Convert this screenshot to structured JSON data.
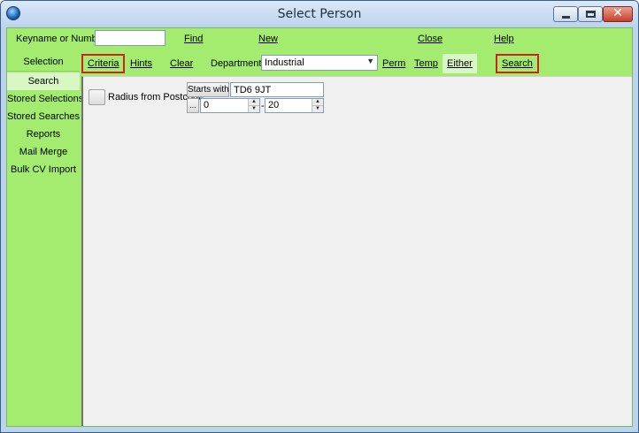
{
  "window": {
    "title": "Select Person",
    "minimize_icon": "minimize-icon",
    "maximize_icon": "maximize-icon",
    "close_icon": "close-icon",
    "close_glyph": "✕"
  },
  "toolbar": {
    "keyname_label": "Keyname or Number",
    "keyname_value": "",
    "find": "Find",
    "new": "New",
    "close": "Close",
    "help": "Help"
  },
  "sidebar": {
    "header": "Selection",
    "items": [
      {
        "label": "Search",
        "active": true
      },
      {
        "label": "Stored Selections"
      },
      {
        "label": "Stored Searches"
      },
      {
        "label": "Reports"
      },
      {
        "label": "Mail Merge"
      },
      {
        "label": "Bulk CV Import"
      }
    ]
  },
  "search_bar": {
    "criteria": "Criteria",
    "hints": "Hints",
    "clear": "Clear",
    "department_label": "Department",
    "department_value": "Industrial",
    "perm": "Perm",
    "temp": "Temp",
    "either": "Either",
    "search": "Search",
    "highlight_color": "#d21f1f"
  },
  "criteria": {
    "radius_label": "Radius from Postcode",
    "starts_with_button": "Starts with",
    "postcode_value": "TD6 9JT",
    "dots_button": "...",
    "min_value": "0",
    "separator": "-",
    "max_value": "20"
  },
  "colors": {
    "panel_green": "#a3ec6f",
    "active_item": "#d9f7c4"
  }
}
